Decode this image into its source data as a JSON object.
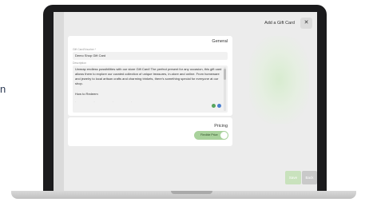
{
  "outside": {
    "stray_char": "n"
  },
  "drawer": {
    "title": "Add a Gift Card",
    "close_glyph": "✕"
  },
  "general": {
    "title": "General",
    "name_label": "Gift Card/Voucher *",
    "name_value": "Demo Shop Gift Card",
    "description_label": "Description",
    "description_text": "Unwrap endless possibilities with our store Gift Card! The perfect present for any occasion, this gift card allows them to explore our curated collection of unique treasures, in-store and online. From homeware and jewelry to local artisan crafts and charming trinkets, there's something special for everyone at our shop.",
    "description_heading2": "How to Redeem"
  },
  "pricing": {
    "title": "Pricing",
    "toggle_label": "Flexible Price",
    "toggle_on": true
  },
  "footer": {
    "save_label": "Save",
    "back_label": "Back"
  },
  "colors": {
    "accent_green": "#a9d29c",
    "save_bg": "#c9e2bd",
    "back_bg": "#c9c9c9"
  }
}
